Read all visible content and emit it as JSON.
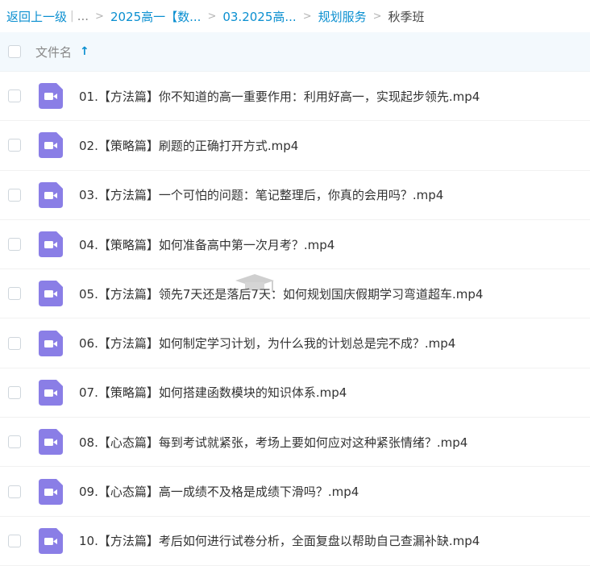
{
  "breadcrumb": {
    "back_label": "返回上一级",
    "ellipsis": "...",
    "items": [
      "2025高一【数...",
      "03.2025高...",
      "规划服务"
    ],
    "current": "秋季班"
  },
  "header": {
    "column_name": "文件名"
  },
  "files": [
    {
      "name": "01.【方法篇】你不知道的高一重要作用：利用好高一，实现起步领先.mp4"
    },
    {
      "name": "02.【策略篇】刷题的正确打开方式.mp4"
    },
    {
      "name": "03.【方法篇】一个可怕的问题：笔记整理后，你真的会用吗？.mp4"
    },
    {
      "name": "04.【策略篇】如何准备高中第一次月考？.mp4"
    },
    {
      "name": "05.【方法篇】领先7天还是落后7天：如何规划国庆假期学习弯道超车.mp4"
    },
    {
      "name": "06.【方法篇】如何制定学习计划，为什么我的计划总是完不成？.mp4"
    },
    {
      "name": "07.【策略篇】如何搭建函数模块的知识体系.mp4"
    },
    {
      "name": "08.【心态篇】每到考试就紧张，考场上要如何应对这种紧张情绪？.mp4"
    },
    {
      "name": "09.【心态篇】高一成绩不及格是成绩下滑吗？.mp4"
    },
    {
      "name": "10.【方法篇】考后如何进行试卷分析，全面复盘以帮助自己查漏补缺.mp4"
    }
  ],
  "colors": {
    "link": "#0a8fd0",
    "icon_purple": "#8a7ee6",
    "header_bg": "#f3f9fd"
  },
  "icons": {
    "file_type": "video-file-icon",
    "sort": "arrow-up-icon",
    "watermark": "graduation-cap-icon"
  }
}
